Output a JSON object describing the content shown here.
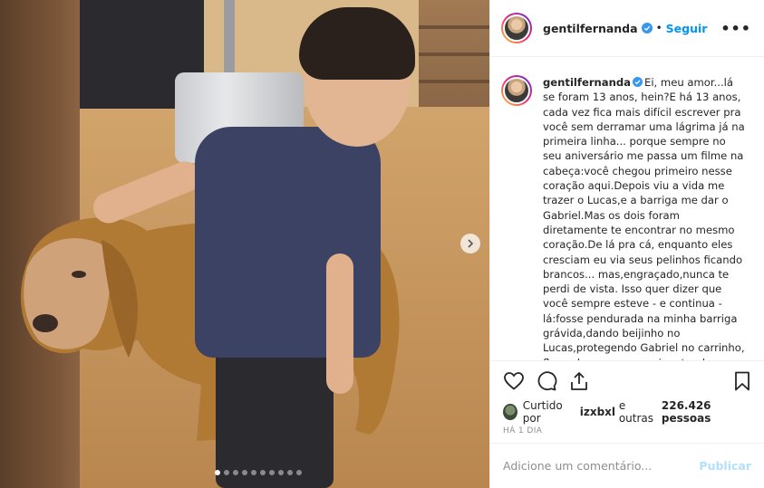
{
  "post": {
    "username": "gentilfernanda",
    "follow_label": "Seguir",
    "separator": "•",
    "more_label": "•••",
    "caption": "Ei, meu amor...lá se foram 13 anos, hein?E há 13 anos, cada vez fica mais difícil escrever pra você sem derramar uma lágrima já na primeira linha... porque sempre no seu aniversário me passa um filme na cabeça:você chegou primeiro nesse coração aqui.Depois viu a vida me trazer o Lucas,e a barriga me dar o Gabriel.Mas os dois foram diretamente te encontrar no mesmo coração.De lá pra cá, enquanto eles cresciam eu via seus pelinhos ficando brancos... mas,engraçado,nunca te perdi de vista. Isso quer dizer que você sempre esteve - e continua - lá:fosse pendurada na minha barriga grávida,dando beijinho no Lucas,protegendo Gabriel no carrinho, flagrado por paparazzi ou tendo",
    "likes_prefix": "Curtido por",
    "likes_user": "izxbxl",
    "likes_middle": "e outras",
    "likes_count": "226.426 pessoas",
    "time": "HÁ 1 DIA",
    "comment_placeholder": "Adicione um comentário...",
    "publish_label": "Publicar"
  },
  "carousel": {
    "slides": 10,
    "active_index": 0
  },
  "colors": {
    "link_blue": "#0095f6",
    "publish_disabled": "#b2dffc",
    "verified_blue": "#3897f0"
  },
  "icons": [
    "verified-icon",
    "heart-icon",
    "comment-icon",
    "share-icon",
    "bookmark-icon",
    "chevron-right-icon",
    "more-icon"
  ]
}
